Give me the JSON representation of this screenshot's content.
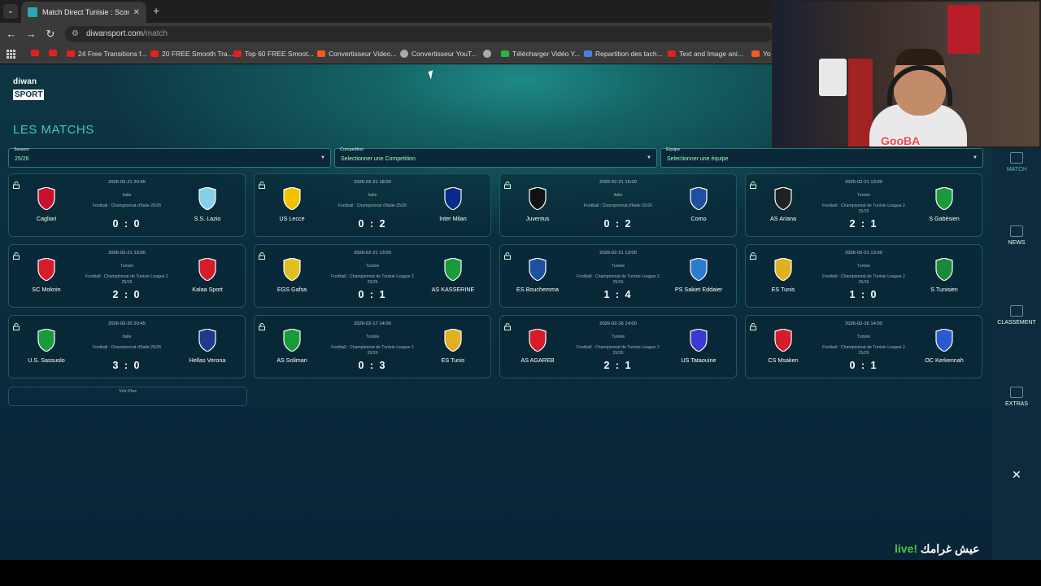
{
  "browser": {
    "tab_title": "Match Direct Tunisie : Scores et",
    "url_host": "diwansport.com",
    "url_path": "/match",
    "bookmarks": [
      {
        "label": "",
        "icon": "youtube-icon"
      },
      {
        "label": "",
        "icon": "youtube-icon"
      },
      {
        "label": "24 Free Transitions f...",
        "icon": "youtube-icon"
      },
      {
        "label": "20 FREE Smooth Tra...",
        "icon": "youtube-icon"
      },
      {
        "label": "Top 60 FREE Smoot...",
        "icon": "youtube-icon"
      },
      {
        "label": "Convertisseur Video...",
        "icon": "z-icon"
      },
      {
        "label": "Convertisseur YouT...",
        "icon": "convert-icon"
      },
      {
        "label": "",
        "icon": "globe-icon"
      },
      {
        "label": "Télécharger Vidéo Y...",
        "icon": "download-icon"
      },
      {
        "label": "Repartition des tach...",
        "icon": "docs-icon"
      },
      {
        "label": "Text and Image ani...",
        "icon": "youtube-icon"
      },
      {
        "label": "Yo",
        "icon": "star-icon"
      }
    ]
  },
  "site": {
    "logo_top": "diwan",
    "logo_bottom": "SPORT",
    "page_title": "LES MATCHS"
  },
  "filters": [
    {
      "label": "Season",
      "value": "25/26"
    },
    {
      "label": "Competition",
      "value": "Selectionner une Competition"
    },
    {
      "label": "Équipe",
      "value": "Selectionner une équipe"
    }
  ],
  "matches": [
    {
      "date": "2026-02-21 20:45",
      "country": "Italie",
      "competition": "Football : Championnat d'Italie 25/26",
      "home": "Cagliari",
      "away": "S.S. Lazio",
      "score": "0 : 0",
      "home_color": "#c8102e",
      "away_color": "#87ceeb"
    },
    {
      "date": "2026-02-21 18:00",
      "country": "Italie",
      "competition": "Football : Championnat d'Italie 25/26",
      "home": "US Lecce",
      "away": "Inter Milan",
      "score": "0 : 2",
      "home_color": "#f2c200",
      "away_color": "#0a2a8c"
    },
    {
      "date": "2026-02-21 15:00",
      "country": "Italie",
      "competition": "Football : Championnat d'Italie 25/26",
      "home": "Juventus",
      "away": "Como",
      "score": "0 : 2",
      "home_color": "#111111",
      "away_color": "#1e4fa0"
    },
    {
      "date": "2026-02-21 13:00",
      "country": "Tunisie",
      "competition": "Football : Championnat de Tunisie League 2 25/26",
      "home": "AS Ariana",
      "away": "S Gabèsien",
      "score": "2 : 1",
      "home_color": "#222222",
      "away_color": "#1a9a3a"
    },
    {
      "date": "2026-02-21 13:00",
      "country": "Tunisie",
      "competition": "Football : Championnat de Tunisie League 2 25/26",
      "home": "SC Moknin",
      "away": "Kalaa Sport",
      "score": "2 : 0",
      "home_color": "#d41c2a",
      "away_color": "#d41c2a"
    },
    {
      "date": "2026-02-21 13:00",
      "country": "Tunisie",
      "competition": "Football : Championnat de Tunisie League 2 25/26",
      "home": "EGS Gafsa",
      "away": "AS KASSERINE",
      "score": "0 : 1",
      "home_color": "#e0c020",
      "away_color": "#1a9a3a"
    },
    {
      "date": "2026-02-21 13:00",
      "country": "Tunisie",
      "competition": "Football : Championnat de Tunisie League 2 25/26",
      "home": "ES Bouchemma",
      "away": "PS Sakiet Eddaier",
      "score": "1 : 4",
      "home_color": "#1e4fa0",
      "away_color": "#2a7ad0"
    },
    {
      "date": "2026-02-21 13:00",
      "country": "Tunisie",
      "competition": "Football : Championnat de Tunisie League 2 25/26",
      "home": "ES Tunis",
      "away": "S Tunisien",
      "score": "1 : 0",
      "home_color": "#e0b020",
      "away_color": "#1a8a3a"
    },
    {
      "date": "2026-02-20 20:45",
      "country": "Italie",
      "competition": "Football : Championnat d'Italie 25/26",
      "home": "U.S. Sassuolo",
      "away": "Hellas Verona",
      "score": "3 : 0",
      "home_color": "#1a9a3a",
      "away_color": "#1e3a8c"
    },
    {
      "date": "2026-02-17 14:00",
      "country": "Tunisie",
      "competition": "Football : Championnat de Tunisie League 1 25/26",
      "home": "AS Soliman",
      "away": "ES Tunis",
      "score": "0 : 3",
      "home_color": "#1a9a3a",
      "away_color": "#e0b020"
    },
    {
      "date": "2026-02-16 14:00",
      "country": "Tunisie",
      "competition": "Football : Championnat de Tunisie League 2 25/26",
      "home": "AS AGAREB",
      "away": "US Tataouine",
      "score": "2 : 1",
      "home_color": "#d41c2a",
      "away_color": "#3a3ad0"
    },
    {
      "date": "2026-02-16 14:00",
      "country": "Tunisie",
      "competition": "Football : Championnat de Tunisie League 2 25/26",
      "home": "CS Msaken",
      "away": "OC Kerkennah",
      "score": "0 : 1",
      "home_color": "#d41c2a",
      "away_color": "#2a5ad0"
    }
  ],
  "voir_plus": "Voir Plus",
  "sidebar": [
    {
      "label": "MATCH",
      "icon": "match-icon"
    },
    {
      "label": "NEWS",
      "icon": "news-icon"
    },
    {
      "label": "CLASSEMENT",
      "icon": "classement-icon"
    },
    {
      "label": "EXTRAS",
      "icon": "extras-icon"
    }
  ],
  "overlay": {
    "webcam_tag": "GooBA",
    "live_arabic": "عيش غرامك",
    "live_word": "live!"
  }
}
